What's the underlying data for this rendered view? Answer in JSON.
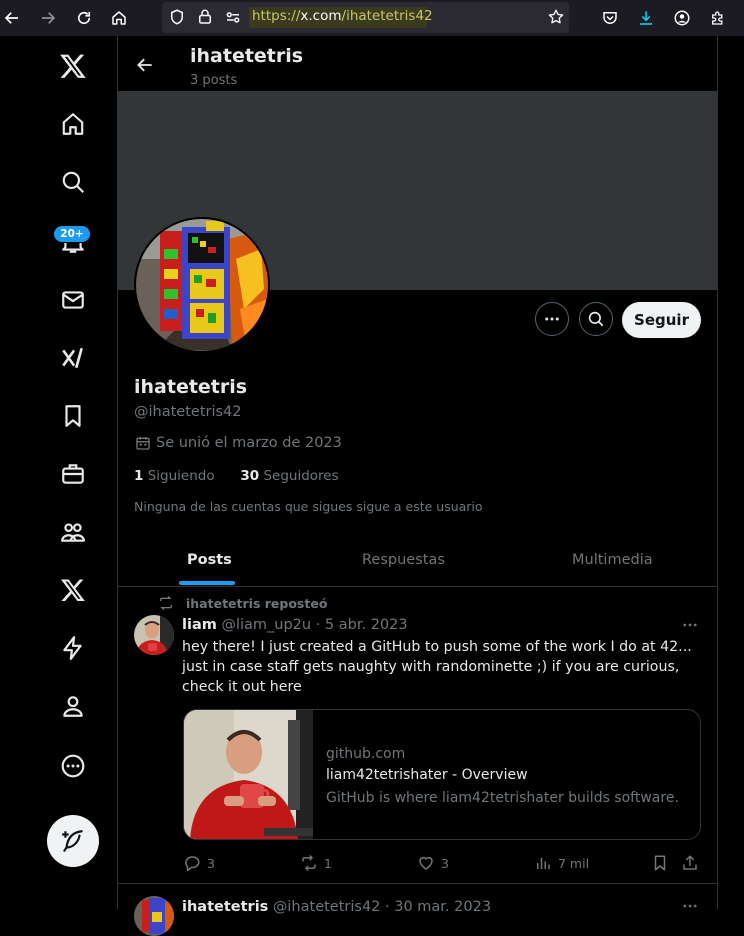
{
  "browser": {
    "url_scheme": "https://",
    "url_domain": "x.com",
    "url_path": "/ihatetetris42"
  },
  "nav": {
    "notification_badge": "20+"
  },
  "header": {
    "name": "ihatetetris",
    "post_count": "3 posts"
  },
  "profile": {
    "name": "ihatetetris",
    "handle": "@ihatetetris42",
    "joined": "Se unió el marzo de 2023",
    "following_count": "1",
    "following_label": "Siguiendo",
    "followers_count": "30",
    "followers_label": "Seguidores",
    "mutual_note": "Ninguna de las cuentas que sigues sigue a este usuario",
    "follow_button": "Seguir"
  },
  "tabs": [
    {
      "label": "Posts",
      "active": true
    },
    {
      "label": "Respuestas",
      "active": false
    },
    {
      "label": "Multimedia",
      "active": false
    }
  ],
  "tweets": [
    {
      "repost_label": "ihatetetris reposteó",
      "author_name": "liam",
      "author_handle": "@liam_up2u",
      "date": "5 abr. 2023",
      "text": "hey there! I just created a GitHub to push some of the work I do at 42... just in case staff gets naughty with randominette ;) if you are curious, check it out here",
      "card": {
        "domain": "github.com",
        "title": "liam42tetrishater - Overview",
        "description": "GitHub is where liam42tetrishater builds software."
      },
      "replies": "3",
      "reposts": "1",
      "likes": "3",
      "views": "7 mil"
    },
    {
      "author_name": "ihatetetris",
      "author_handle": "@ihatetetris42",
      "date": "30 mar. 2023"
    }
  ]
}
